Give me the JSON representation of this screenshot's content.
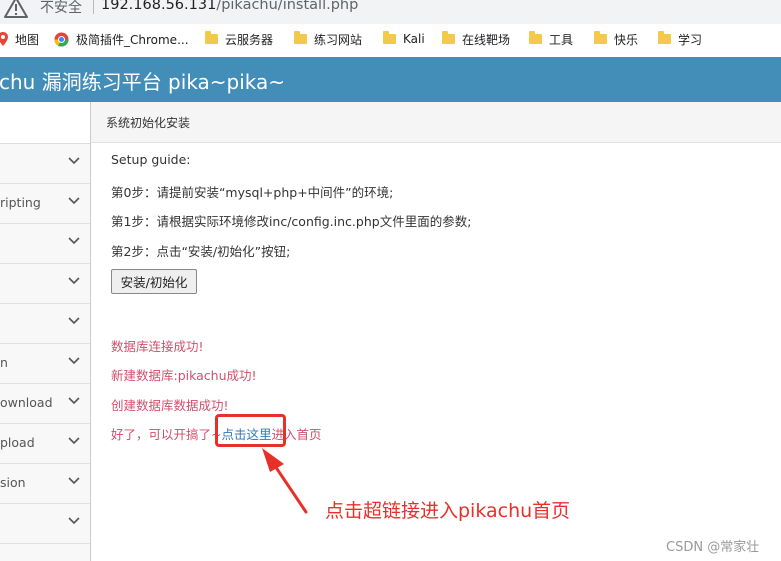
{
  "browser": {
    "insecure_label": "不安全",
    "url_host": "192.168.56.131",
    "url_path": "/pikachu/install.php"
  },
  "bookmarks": [
    {
      "label": "地图",
      "icon": "map-pin-icon"
    },
    {
      "label": "极简插件_Chrome...",
      "icon": "extension-icon"
    },
    {
      "label": "云服务器",
      "icon": "folder-icon"
    },
    {
      "label": "练习网站",
      "icon": "folder-icon"
    },
    {
      "label": "Kali",
      "icon": "folder-icon"
    },
    {
      "label": "在线靶场",
      "icon": "folder-icon"
    },
    {
      "label": "工具",
      "icon": "folder-icon"
    },
    {
      "label": "快乐",
      "icon": "folder-icon"
    },
    {
      "label": "学习",
      "icon": "folder-icon"
    }
  ],
  "header": {
    "title": "chu 漏洞练习平台 pika~pika~"
  },
  "sidebar": {
    "items": [
      {
        "label": ""
      },
      {
        "label": "ripting"
      },
      {
        "label": ""
      },
      {
        "label": ""
      },
      {
        "label": ""
      },
      {
        "label": "n"
      },
      {
        "label": "ownload"
      },
      {
        "label": "pload"
      },
      {
        "label": "sion"
      },
      {
        "label": ""
      },
      {
        "label": ""
      }
    ]
  },
  "breadcrumb": {
    "label": "系统初始化安装"
  },
  "guide": {
    "heading": "Setup guide:",
    "step0": "第0步：请提前安装“mysql+php+中间件”的环境;",
    "step1": "第1步：请根据实际环境修改inc/config.inc.php文件里面的参数;",
    "step2": "第2步：点击“安装/初始化”按钮;",
    "install_button": "安装/初始化"
  },
  "messages": {
    "db_connect": "数据库连接成功!",
    "db_create": "新建数据库:pikachu成功!",
    "data_create": "创建数据库数据成功!",
    "ready_prefix": "好了，可以开搞了~",
    "link_text": "点击这里",
    "link_suffix": "进入首页"
  },
  "annotation": {
    "text": "点击超链接进入pikachu首页",
    "color": "#e8302b"
  },
  "watermark": "CSDN @常家壮",
  "colors": {
    "header_bg": "#438eb9",
    "success_text": "#d14f6c",
    "link": "#337ab7"
  }
}
